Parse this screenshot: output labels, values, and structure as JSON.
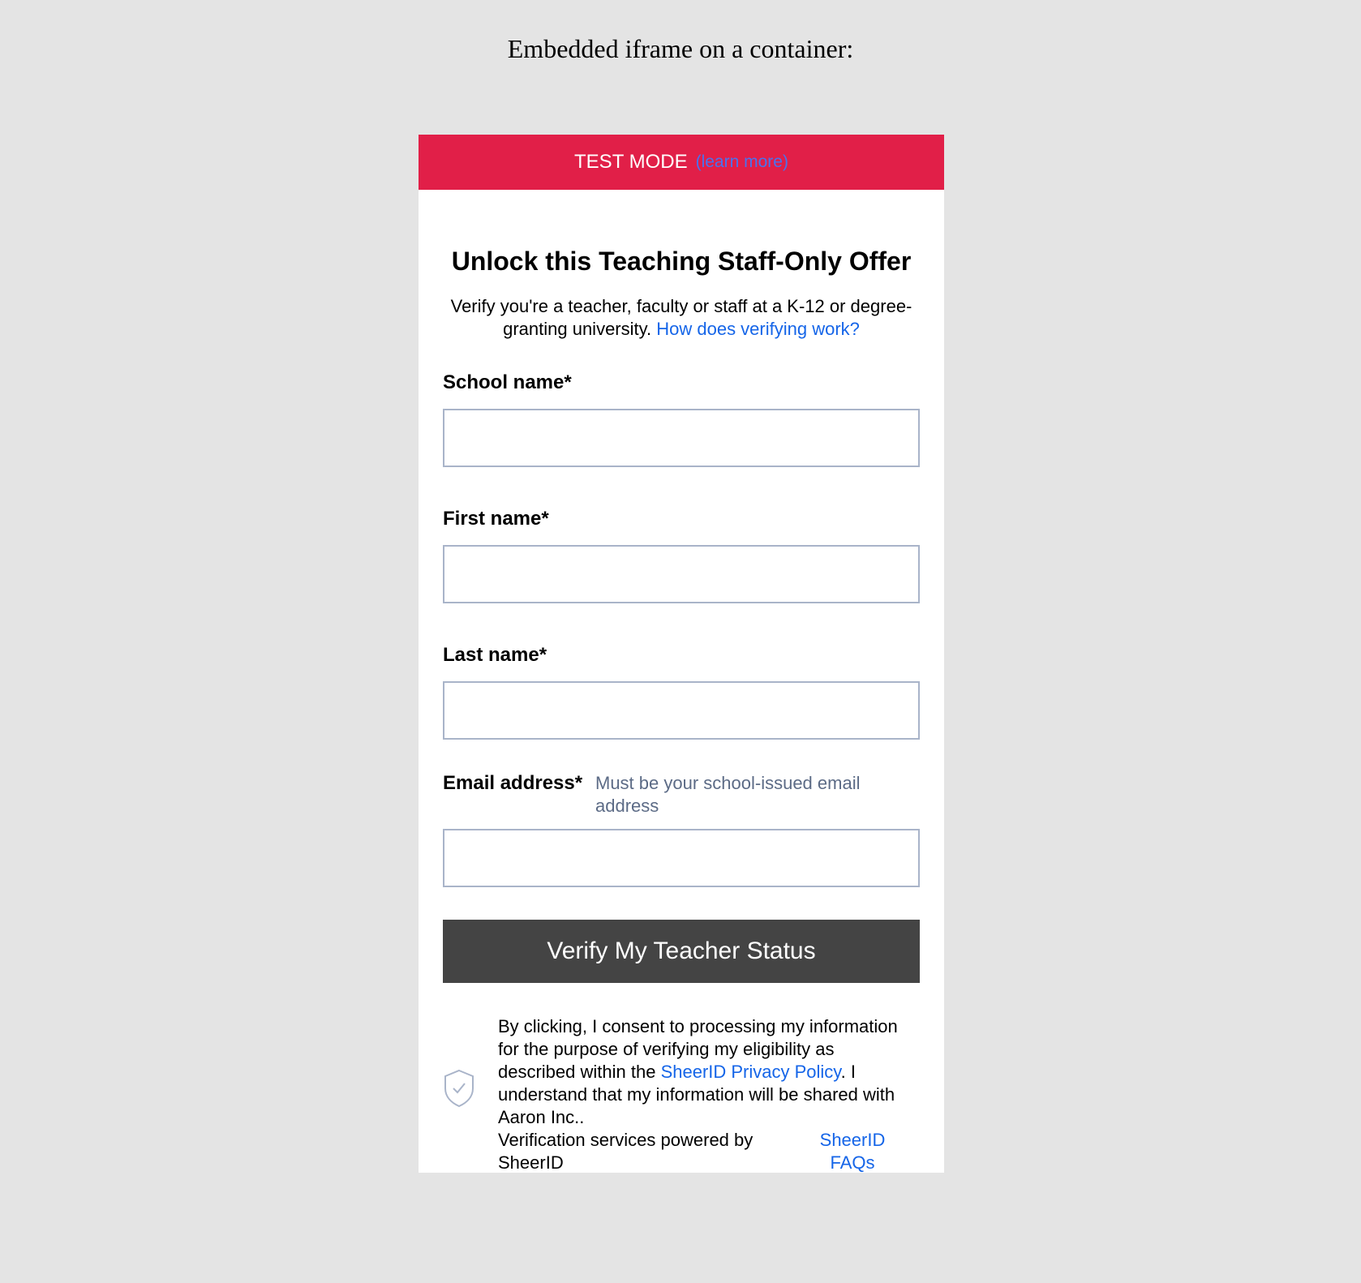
{
  "page": {
    "heading": "Embedded iframe on a container:"
  },
  "banner": {
    "mode_label": "TEST MODE",
    "learn_more": "(learn more)",
    "color": "#e11f48"
  },
  "form": {
    "title": "Unlock this Teaching Staff-Only Offer",
    "description": "Verify you're a teacher, faculty or staff at a K-12 or degree-granting university.",
    "how_link": "How does verifying work?",
    "fields": {
      "school": {
        "label": "School name*",
        "value": "",
        "placeholder": ""
      },
      "first_name": {
        "label": "First name*",
        "value": "",
        "placeholder": ""
      },
      "last_name": {
        "label": "Last name*",
        "value": "",
        "placeholder": ""
      },
      "email": {
        "label": "Email address*",
        "hint": "Must be your school-issued email address",
        "value": "",
        "placeholder": ""
      }
    },
    "submit_label": "Verify My Teacher Status",
    "submit_color": "#444444"
  },
  "consent": {
    "icon": "shield-check-icon",
    "text_before": "By clicking, I consent to processing my information for the purpose of verifying my eligibility as described within the ",
    "privacy_link": "SheerID Privacy Policy",
    "text_after": ". I understand that my information will be shared with Aaron Inc..",
    "powered_by": "Verification services powered by SheerID",
    "faq_link": "SheerID FAQs",
    "link_color": "#1565e8"
  }
}
